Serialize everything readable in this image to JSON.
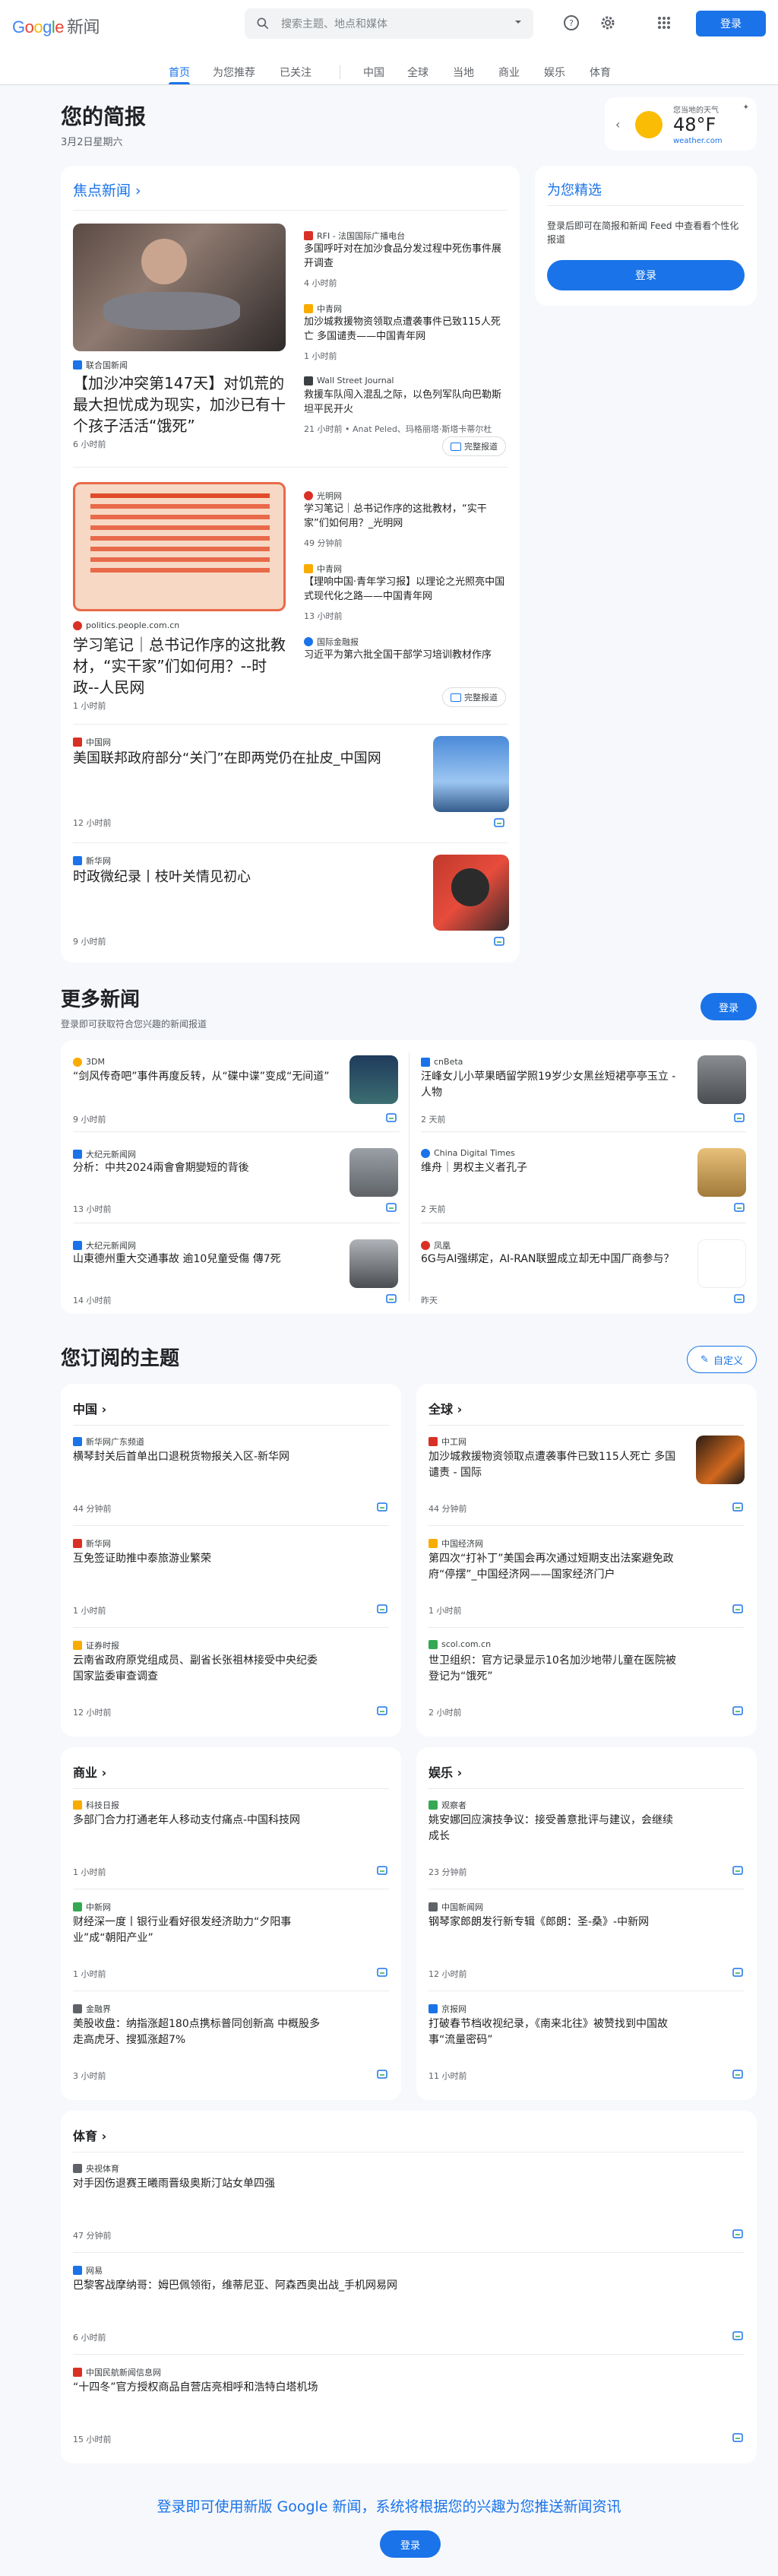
{
  "header": {
    "logo_google": "Google",
    "logo_news": "新闻",
    "search_placeholder": "搜索主题、地点和媒体",
    "signin": "登录"
  },
  "nav": {
    "tabs": [
      "首页",
      "为您推荐",
      "已关注",
      "中国",
      "全球",
      "当地",
      "商业",
      "娱乐",
      "体育"
    ]
  },
  "briefing": {
    "title": "您的简报",
    "date": "3月2日星期六"
  },
  "weather": {
    "label": "您当地的天气",
    "temp": "48°F",
    "source": "weather.com"
  },
  "top": {
    "heading": "焦点新闻 ›",
    "s1": {
      "main_src": "联合国新闻",
      "main_title": "【加沙冲突第147天】对饥荒的最大担忧成为现实，加沙已有十个孩子活活“饿死”",
      "main_time": "6 小时前",
      "r1_src": "RFI - 法国国际广播电台",
      "r1_title": "多国呼吁对在加沙食品分发过程中死伤事件展开调查",
      "r1_time": "4 小时前",
      "r2_src": "中青网",
      "r2_title": "加沙城救援物资领取点遭袭事件已致115人死亡 多国谴责——中国青年网",
      "r2_time": "1 小时前",
      "r3_src": "Wall Street Journal",
      "r3_title": "救援车队闯入混乱之际，以色列军队向巴勒斯坦平民开火",
      "r3_time": "21 小时前 • Anat Peled、玛格丽塔·斯塔卡蒂尔杜",
      "full": "完整报道"
    },
    "s2": {
      "main_src": "politics.people.com.cn",
      "main_title": "学习笔记｜总书记作序的这批教材，“实干家”们如何用？--时政--人民网",
      "main_time": "1 小时前",
      "r1_src": "光明网",
      "r1_title": "学习笔记｜总书记作序的这批教材，“实干家”们如何用？_光明网",
      "r1_time": "49 分钟前",
      "r2_src": "中青网",
      "r2_title": "【理响中国·青年学习报】以理论之光照亮中国式现代化之路——中国青年网",
      "r2_time": "13 小时前",
      "r3_src": "国际金融报",
      "r3_title": "习近平为第六批全国干部学习培训教材作序",
      "r3_time": "",
      "full": "完整报道"
    },
    "s3": {
      "src": "中国网",
      "title": "美国联邦政府部分“关门”在即两党仍在扯皮_中国网",
      "time": "12 小时前"
    },
    "s4": {
      "src": "新华网",
      "title": "时政微纪录丨枝叶关情见初心",
      "time": "9 小时前"
    }
  },
  "picks": {
    "title": "为您精选",
    "desc": "登录后即可在简报和新闻 Feed 中查看看个性化报道",
    "btn": "登录"
  },
  "more": {
    "title": "更多新闻",
    "sub": "登录即可获取符合您兴趣的新闻报道",
    "btn": "登录",
    "items": [
      {
        "src": "3DM",
        "title": "“剑风传奇吧”事件再度反转，从“碟中谍”变成“无间道”",
        "time": "9 小时前"
      },
      {
        "src": "cnBeta",
        "title": "汪峰女儿小苹果晒留学照19岁少女黑丝短裙亭亭玉立 - 人物",
        "time": "2 天前"
      },
      {
        "src": "大纪元新闻网",
        "title": "分析：中共2024兩會會期變短的背後",
        "time": "13 小时前"
      },
      {
        "src": "China Digital Times",
        "title": "维舟｜男权主义者孔子",
        "time": "2 天前"
      },
      {
        "src": "大纪元新闻网",
        "title": "山東德州重大交通事故 逾10兒童受傷 傳7死",
        "time": "14 小时前"
      },
      {
        "src": "凤凰",
        "title": "6G与AI强绑定，AI-RAN联盟成立却无中国厂商参与？",
        "time": "昨天"
      }
    ]
  },
  "topics": {
    "title": "您订阅的主题",
    "customize": "自定义",
    "china": {
      "head": "中国 ›",
      "items": [
        {
          "src": "新华网广东频道",
          "title": "横琴封关后首单出口退税货物报关入区-新华网",
          "time": "44 分钟前"
        },
        {
          "src": "新华网",
          "title": "互免签证助推中泰旅游业繁荣",
          "time": "1 小时前"
        },
        {
          "src": "证券时报",
          "title": "云南省政府原党组成员、副省长张祖林接受中央纪委国家监委审查调查",
          "time": "12 小时前"
        }
      ]
    },
    "world": {
      "head": "全球 ›",
      "items": [
        {
          "src": "中工网",
          "title": "加沙城救援物资领取点遭袭事件已致115人死亡 多国谴责 - 国际",
          "time": "44 分钟前"
        },
        {
          "src": "中国经济网",
          "title": "第四次“打补丁”美国会再次通过短期支出法案避免政府“停摆”_中国经济网——国家经济门户",
          "time": "1 小时前"
        },
        {
          "src": "scol.com.cn",
          "title": "世卫组织：官方记录显示10名加沙地带儿童在医院被登记为“饿死”",
          "time": "2 小时前"
        }
      ]
    },
    "biz": {
      "head": "商业 ›",
      "items": [
        {
          "src": "科技日报",
          "title": "多部门合力打通老年人移动支付痛点-中国科技网",
          "time": "1 小时前"
        },
        {
          "src": "中新网",
          "title": "财经深一度丨银行业看好很发经济助力“夕阳事业”成“朝阳产业”",
          "time": "1 小时前"
        },
        {
          "src": "金融界",
          "title": "美股收盘：纳指涨超180点携标普同创新高 中概股多走高虎牙、搜狐涨超7%",
          "time": "3 小时前"
        }
      ]
    },
    "ent": {
      "head": "娱乐 ›",
      "items": [
        {
          "src": "观察者",
          "title": "姚安娜回应演技争议：接受善意批评与建议，会继续成长",
          "time": "23 分钟前"
        },
        {
          "src": "中国新闻网",
          "title": "钢琴家郎朗发行新专辑《郎朗：圣-桑》-中新网",
          "time": "12 小时前"
        },
        {
          "src": "京报网",
          "title": "打破春节档收视纪录，《南来北往》被赞找到中国故事“流量密码”",
          "time": "11 小时前"
        }
      ]
    },
    "sport": {
      "head": "体育 ›",
      "items": [
        {
          "src": "央视体育",
          "title": "对手因伤退赛王曦雨晋级奥斯汀站女单四强",
          "time": "47 分钟前"
        },
        {
          "src": "网易",
          "title": "巴黎客战摩纳哥：姆巴佩领衔，维蒂尼亚、阿森西奥出战_手机网易网",
          "time": "6 小时前"
        },
        {
          "src": "中国民航新闻信息网",
          "title": "“十四冬”官方授权商品自营店亮相呼和浩特白塔机场",
          "time": "15 小时前"
        }
      ]
    }
  },
  "footer": {
    "text": "登录即可使用新版 Google 新闻，系统将根据您的兴趣为您推送新闻资讯",
    "btn": "登录"
  }
}
